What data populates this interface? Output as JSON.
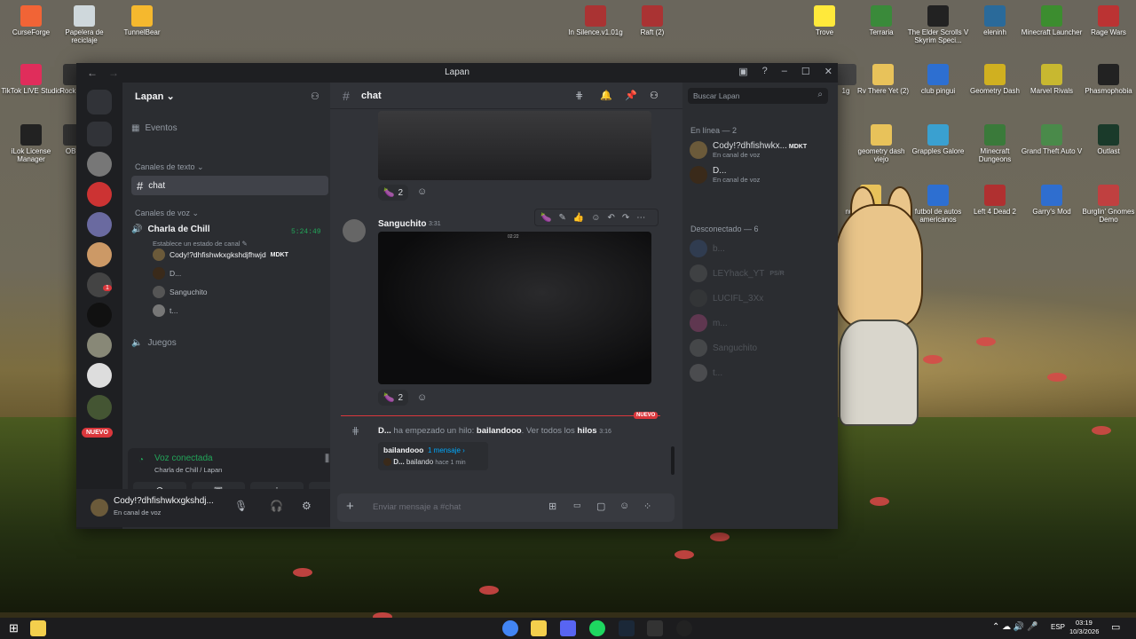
{
  "desktop": {
    "icons": [
      {
        "label": "CurseForge",
        "color": "#f16436"
      },
      {
        "label": "Papelera de reciclaje",
        "color": "#cfd8dc"
      },
      {
        "label": "TunnelBear",
        "color": "#f5b82e"
      },
      {
        "label": "In Silence.v1.01g",
        "color": "#a33"
      },
      {
        "label": "Raft (2)",
        "color": "#a33"
      },
      {
        "label": "Trove",
        "color": "#ffe93b"
      },
      {
        "label": "Terraria",
        "color": "#3a8a3a"
      },
      {
        "label": "The Elder Scrolls V Skyrim Speci...",
        "color": "#222"
      },
      {
        "label": "eleninh",
        "color": "#2a6a9a"
      },
      {
        "label": "Minecraft Launcher",
        "color": "#3c8d2f"
      },
      {
        "label": "Rage Wars",
        "color": "#b33"
      },
      {
        "label": "TikTok LIVE Studio",
        "color": "#e02d5b"
      },
      {
        "label": "Rock L...",
        "color": "#333"
      },
      {
        "label": "1g",
        "color": "#444"
      },
      {
        "label": "Rv There Yet (2)",
        "color": "#e8c25a"
      },
      {
        "label": "club pingui",
        "color": "#2d6fd1"
      },
      {
        "label": "Geometry Dash",
        "color": "#d0b020"
      },
      {
        "label": "Marvel Rivals",
        "color": "#c8b830"
      },
      {
        "label": "Phasmophobia",
        "color": "#222"
      },
      {
        "label": "iLok License Manager",
        "color": "#222"
      },
      {
        "label": "OB...",
        "color": "#333"
      },
      {
        "label": "geometry dash viejo",
        "color": "#e8c25a"
      },
      {
        "label": "Grapples Galore",
        "color": "#3aa0d0"
      },
      {
        "label": "Minecraft Dungeons",
        "color": "#3a7a3a"
      },
      {
        "label": "Grand Theft Auto V",
        "color": "#4a8a4a"
      },
      {
        "label": "Outlast",
        "color": "#1a3a2a"
      },
      {
        "label": "nuevo geometry dash",
        "color": "#e8c25a"
      },
      {
        "label": "futbol de autos americanos",
        "color": "#2d6fd1"
      },
      {
        "label": "Left 4 Dead 2",
        "color": "#b03030"
      },
      {
        "label": "Garry's Mod",
        "color": "#2f6ecf"
      },
      {
        "label": "Burglin' Gnomes Demo",
        "color": "#c04040"
      }
    ]
  },
  "window": {
    "title": "Lapan",
    "nav_back": "←",
    "nav_forward": "→",
    "controls": {
      "inbox": "▣",
      "help": "?",
      "minimize": "–",
      "maximize": "☐",
      "close": "✕"
    }
  },
  "servers": {
    "nuevo_badge": "NUEVO",
    "notif_count": "1"
  },
  "sidebar": {
    "server_name": "Lapan",
    "events_label": "Eventos",
    "text_category": "Canales de texto",
    "text_channel": "chat",
    "voice_category": "Canales de voz",
    "voice_channel": "Charla de Chill",
    "voice_timer": "5:24:49",
    "voice_status": "Establece un estado de canal",
    "voice_users": [
      {
        "name": "Cody!?dhfishwkxgkshdjfhwjd",
        "tag": "MDKT",
        "color": "#6b5a3a"
      },
      {
        "name": "D...",
        "tag": "",
        "color": "#3a2a1a"
      },
      {
        "name": "Sanguchito",
        "tag": "",
        "color": "#555"
      },
      {
        "name": "t...",
        "tag": "",
        "color": "#777"
      }
    ],
    "other_channel": "Juegos",
    "voice_connected": "Voz conectada",
    "voice_connected_sub": "Charla de Chill / Lapan",
    "user_name": "Cody!?dhfishwkxgkshdj...",
    "user_status": "En canal de voz"
  },
  "chat": {
    "channel_name": "chat",
    "search_placeholder": "Buscar Lapan",
    "msg1_reaction_count": "2",
    "msg2_author": "Sanguchito",
    "msg2_time": "3:31",
    "msg2_reaction_count": "2",
    "video_time": "02:22",
    "new_divider": "NUEVO",
    "thread_author": "D...",
    "thread_text": "ha empezado un hilo:",
    "thread_name": "bailandooo",
    "thread_see_all": "Ver todos los",
    "thread_hilos": "hilos",
    "thread_time": "3:16",
    "thread_box_name": "bailandooo",
    "thread_box_count": "1 mensaje ›",
    "thread_box_user": "D...",
    "thread_box_msg": "bailando",
    "thread_box_time": "hace 1 min",
    "input_placeholder": "Enviar mensaje a #chat"
  },
  "members": {
    "online_header": "En línea — 2",
    "online": [
      {
        "name": "Cody!?dhfishwkx...",
        "tag": "MDKT",
        "status": "En canal de voz",
        "color": "#6b5a3a"
      },
      {
        "name": "D...",
        "tag": "",
        "status": "En canal de voz",
        "color": "#3a2a1a"
      }
    ],
    "offline_header": "Desconectado — 6",
    "offline": [
      {
        "name": "b...",
        "tag": "",
        "color": "#3a5a8a"
      },
      {
        "name": "LEYhack_YT",
        "tag": "PS/R",
        "color": "#666"
      },
      {
        "name": "LUCIFL_3Xx",
        "tag": "",
        "color": "#444"
      },
      {
        "name": "m...",
        "tag": "",
        "color": "#c04a8a"
      },
      {
        "name": "Sanguchito",
        "tag": "",
        "color": "#777"
      },
      {
        "name": "t...",
        "tag": "",
        "color": "#888"
      }
    ]
  },
  "taskbar": {
    "lang": "ESP",
    "time": "03:19",
    "date": "10/3/2026"
  }
}
